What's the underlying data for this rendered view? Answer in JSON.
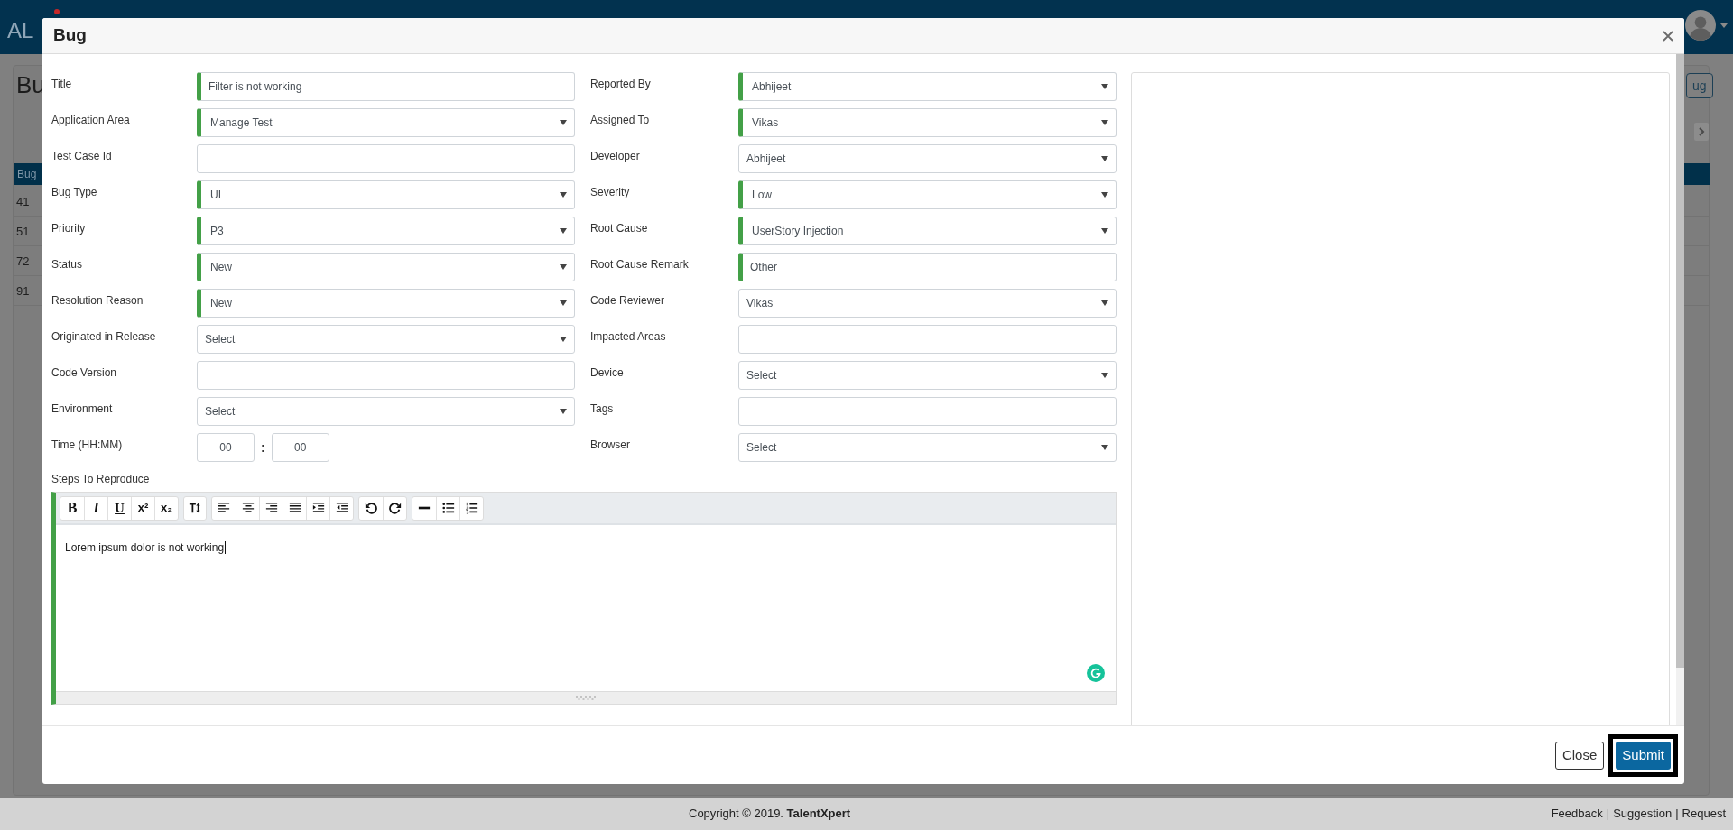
{
  "navbar": {
    "brand": "AL"
  },
  "background_page": {
    "heading": "Bu",
    "table_header": "Bug",
    "row_ids": [
      "41",
      "51",
      "72",
      "91"
    ],
    "button": "ug"
  },
  "modal": {
    "title": "Bug",
    "left_fields": [
      {
        "label": "Title",
        "kind": "text",
        "value": "Filter is not working",
        "required": true
      },
      {
        "label": "Application Area",
        "kind": "select",
        "value": "Manage Test",
        "required": true
      },
      {
        "label": "Test Case Id",
        "kind": "text",
        "required": false
      },
      {
        "label": "Bug Type",
        "kind": "select",
        "value": "UI",
        "required": true
      },
      {
        "label": "Priority",
        "kind": "select",
        "value": "P3",
        "required": true
      },
      {
        "label": "Status",
        "kind": "select",
        "value": "New",
        "required": true
      },
      {
        "label": "Resolution Reason",
        "kind": "select",
        "value": "New",
        "required": true
      },
      {
        "label": "Originated in Release",
        "kind": "select",
        "value": "Select",
        "required": false
      },
      {
        "label": "Code Version",
        "kind": "text",
        "required": false
      },
      {
        "label": "Environment",
        "kind": "select",
        "value": "Select",
        "required": false
      },
      {
        "label": "Time (HH:MM)",
        "kind": "time",
        "hours": "00",
        "separator": ":",
        "minutes": "00"
      }
    ],
    "right_fields": [
      {
        "label": "Reported By",
        "kind": "select",
        "value": "Abhijeet",
        "required": true
      },
      {
        "label": "Assigned To",
        "kind": "select",
        "value": "Vikas",
        "required": true
      },
      {
        "label": "Developer",
        "kind": "select",
        "value": "Abhijeet",
        "required": false
      },
      {
        "label": "Severity",
        "kind": "select",
        "value": "Low",
        "required": true
      },
      {
        "label": "Root Cause",
        "kind": "select",
        "value": "UserStory Injection",
        "required": true
      },
      {
        "label": "Root Cause Remark",
        "kind": "text",
        "value": "Other",
        "required": true
      },
      {
        "label": "Code Reviewer",
        "kind": "select",
        "value": "Vikas",
        "required": false
      },
      {
        "label": "Impacted Areas",
        "kind": "text",
        "required": false
      },
      {
        "label": "Device",
        "kind": "select",
        "value": "Select",
        "required": false
      },
      {
        "label": "Tags",
        "kind": "text",
        "required": false
      },
      {
        "label": "Browser",
        "kind": "select",
        "value": "Select",
        "required": false
      }
    ],
    "steps": {
      "label": "Steps To Reproduce",
      "required": true,
      "text": "Lorem ipsum dolor is not working",
      "toolbar": [
        [
          {
            "kind": "bold",
            "text": "B"
          },
          {
            "kind": "italic",
            "text": "I"
          },
          {
            "kind": "underline",
            "text": "U"
          },
          {
            "kind": "superscript",
            "text": "x²"
          },
          {
            "kind": "subscript",
            "text": "x₂"
          }
        ],
        [
          {
            "kind": "font-size"
          }
        ],
        [
          {
            "kind": "align-left"
          },
          {
            "kind": "align-center"
          },
          {
            "kind": "align-right"
          },
          {
            "kind": "justify"
          },
          {
            "kind": "indent"
          },
          {
            "kind": "outdent"
          }
        ],
        [
          {
            "kind": "undo"
          },
          {
            "kind": "redo"
          }
        ],
        [
          {
            "kind": "rule"
          },
          {
            "kind": "bullet-list"
          },
          {
            "kind": "numbered-list"
          }
        ]
      ]
    },
    "buttons": [
      {
        "label": "Close",
        "kind": "secondary",
        "focused": false
      },
      {
        "label": "Submit",
        "kind": "primary",
        "focused": true
      }
    ]
  },
  "footer": {
    "copyright": "Copyright © 2019. **TalentXpert**",
    "links": [
      "Feedback",
      "Suggestion",
      "Request"
    ],
    "separator": "|"
  }
}
